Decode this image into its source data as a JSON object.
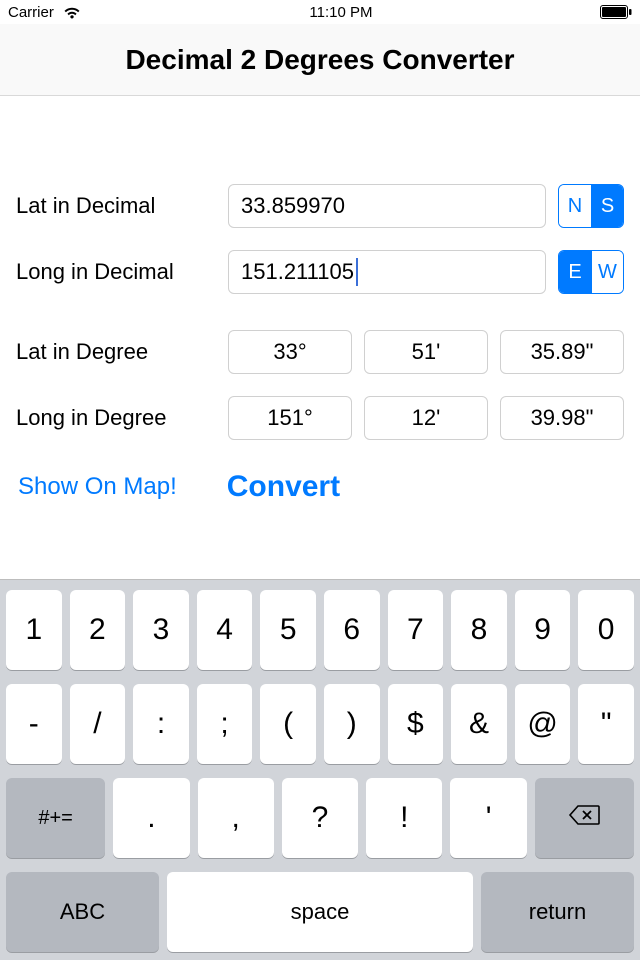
{
  "status_bar": {
    "carrier": "Carrier",
    "time": "11:10 PM"
  },
  "header": {
    "title": "Decimal 2 Degrees Converter"
  },
  "labels": {
    "lat_dec": "Lat in Decimal",
    "long_dec": "Long in Decimal",
    "lat_deg": "Lat in Degree",
    "long_deg": "Long in Degree"
  },
  "values": {
    "lat_dec": "33.859970",
    "long_dec": "151.211105",
    "lat_d": "33°",
    "lat_m": "51'",
    "lat_s": "35.89\"",
    "long_d": "151°",
    "long_m": "12'",
    "long_s": "39.98\""
  },
  "seg": {
    "n": "N",
    "s": "S",
    "e": "E",
    "w": "W"
  },
  "actions": {
    "show_map": "Show On Map!",
    "convert": "Convert"
  },
  "keyboard": {
    "row1": [
      "1",
      "2",
      "3",
      "4",
      "5",
      "6",
      "7",
      "8",
      "9",
      "0"
    ],
    "row2": [
      "-",
      "/",
      ":",
      ";",
      "(",
      ")",
      "$",
      "&",
      "@",
      "\""
    ],
    "row3_shift": "#+=",
    "row3": [
      ".",
      ",",
      "?",
      "!",
      "'"
    ],
    "row4_abc": "ABC",
    "row4_space": "space",
    "row4_return": "return"
  }
}
